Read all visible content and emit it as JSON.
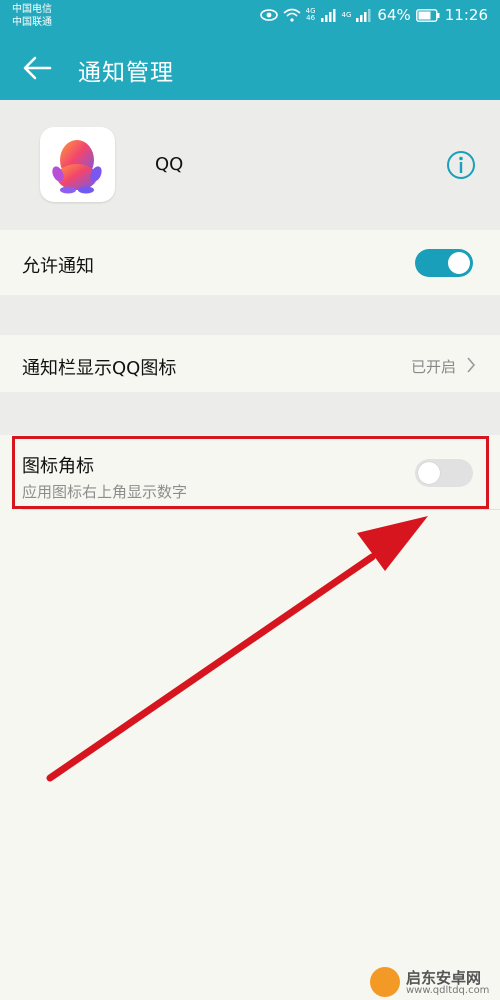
{
  "status_bar": {
    "carrier_1": "中国电信",
    "carrier_2": "中国联通",
    "net_1": "4G",
    "net_2": "46",
    "net_3": "4G",
    "battery_percent": "64%",
    "time": "11:26"
  },
  "toolbar": {
    "title": "通知管理"
  },
  "app": {
    "name": "QQ"
  },
  "settings": {
    "allow_notifications": {
      "label": "允许通知",
      "enabled": true
    },
    "statusbar_icon": {
      "label": "通知栏显示QQ图标",
      "value": "已开启"
    },
    "badge": {
      "label": "图标角标",
      "sublabel": "应用图标右上角显示数字",
      "enabled": false
    }
  },
  "watermark": {
    "name": "启东安卓网",
    "url": "www.qdltdq.com"
  },
  "colors": {
    "accent": "#23a9bd",
    "toggle_on": "#1a9fba",
    "annotation": "#d6151f"
  }
}
